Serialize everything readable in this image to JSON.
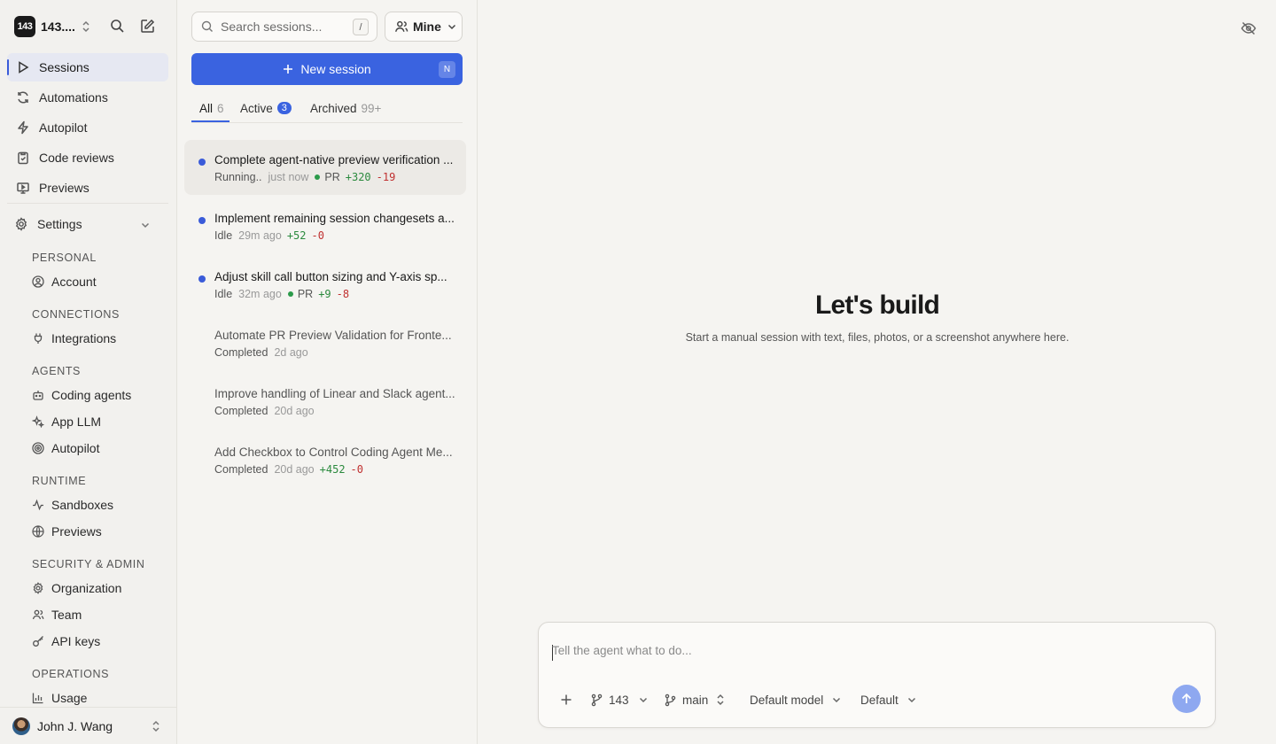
{
  "workspace": {
    "logo": "143",
    "name": "143...."
  },
  "nav": [
    {
      "label": "Sessions",
      "icon": "play-icon",
      "active": true
    },
    {
      "label": "Automations",
      "icon": "refresh-icon"
    },
    {
      "label": "Autopilot",
      "icon": "bolt-icon"
    },
    {
      "label": "Code reviews",
      "icon": "clipboard-icon"
    },
    {
      "label": "Previews",
      "icon": "monitor-icon"
    }
  ],
  "settings": {
    "label": "Settings",
    "sections": [
      {
        "label": "PERSONAL",
        "items": [
          {
            "label": "Account",
            "icon": "user-circle-icon"
          }
        ]
      },
      {
        "label": "CONNECTIONS",
        "items": [
          {
            "label": "Integrations",
            "icon": "plug-icon"
          }
        ]
      },
      {
        "label": "AGENTS",
        "items": [
          {
            "label": "Coding agents",
            "icon": "bot-icon"
          },
          {
            "label": "App LLM",
            "icon": "sparkles-icon"
          },
          {
            "label": "Autopilot",
            "icon": "target-icon"
          }
        ]
      },
      {
        "label": "RUNTIME",
        "items": [
          {
            "label": "Sandboxes",
            "icon": "activity-icon"
          },
          {
            "label": "Previews",
            "icon": "globe-icon"
          }
        ]
      },
      {
        "label": "SECURITY & ADMIN",
        "items": [
          {
            "label": "Organization",
            "icon": "gear-icon"
          },
          {
            "label": "Team",
            "icon": "users-icon"
          },
          {
            "label": "API keys",
            "icon": "key-icon"
          }
        ]
      },
      {
        "label": "OPERATIONS",
        "items": [
          {
            "label": "Usage",
            "icon": "bar-chart-icon"
          }
        ]
      }
    ]
  },
  "user": {
    "name": "John J. Wang"
  },
  "sessions_panel": {
    "search_placeholder": "Search sessions...",
    "search_shortcut": "/",
    "filter_label": "Mine",
    "new_session_label": "New session",
    "new_session_shortcut": "N",
    "tabs": [
      {
        "label": "All",
        "count": "6",
        "active": true
      },
      {
        "label": "Active",
        "count": "3"
      },
      {
        "label": "Archived",
        "count": "99+"
      }
    ],
    "sessions": [
      {
        "title": "Complete agent-native preview verification ...",
        "status": "Running..",
        "time": "just now",
        "pr": "PR",
        "additions": "+320",
        "deletions": "-19",
        "dot": true,
        "selected": true
      },
      {
        "title": "Implement remaining session changesets a...",
        "status": "Idle",
        "time": "29m ago",
        "additions": "+52",
        "deletions": "-0",
        "dot": true
      },
      {
        "title": "Adjust skill call button sizing and Y-axis sp...",
        "status": "Idle",
        "time": "32m ago",
        "pr": "PR",
        "additions": "+9",
        "deletions": "-8",
        "dot": true
      },
      {
        "title": "Automate PR Preview Validation for Fronte...",
        "status": "Completed",
        "time": "2d ago"
      },
      {
        "title": "Improve handling of Linear and Slack agent...",
        "status": "Completed",
        "time": "20d ago"
      },
      {
        "title": "Add Checkbox to Control Coding Agent Me...",
        "status": "Completed",
        "time": "20d ago",
        "additions": "+452",
        "deletions": "-0"
      }
    ]
  },
  "main": {
    "title": "Let's build",
    "subtitle": "Start a manual session with text, files, photos, or a screenshot anywhere here.",
    "composer": {
      "placeholder": "Tell the agent what to do...",
      "repo": "143",
      "branch": "main",
      "model": "Default model",
      "mode": "Default"
    }
  },
  "colors": {
    "accent": "#3a63e0",
    "additions": "#2b8a3e",
    "deletions": "#c03030",
    "send_disabled": "#8ea8f0"
  }
}
